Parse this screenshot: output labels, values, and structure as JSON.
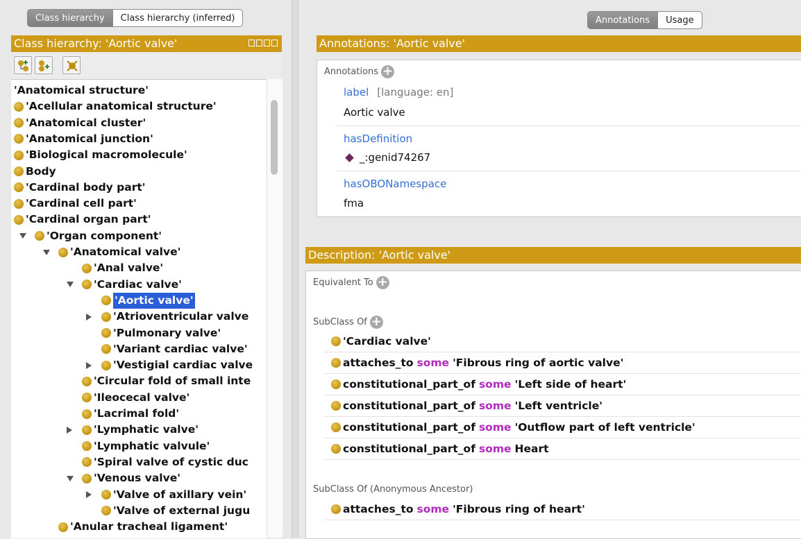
{
  "left_tabs": [
    "Class hierarchy",
    "Class hierarchy (inferred)"
  ],
  "class_hierarchy": {
    "title": "Class hierarchy: 'Aortic valve'",
    "tree": [
      {
        "label": "'Anatomical structure'",
        "level": 0,
        "toggle": "none",
        "bullet": false
      },
      {
        "label": "'Acellular anatomical structure'",
        "level": 0,
        "toggle": "none",
        "bullet": true
      },
      {
        "label": "'Anatomical cluster'",
        "level": 0,
        "toggle": "none",
        "bullet": true
      },
      {
        "label": "'Anatomical junction'",
        "level": 0,
        "toggle": "none",
        "bullet": true
      },
      {
        "label": "'Biological macromolecule'",
        "level": 0,
        "toggle": "none",
        "bullet": true
      },
      {
        "label": "Body",
        "level": 0,
        "toggle": "none",
        "bullet": true
      },
      {
        "label": "'Cardinal body part'",
        "level": 0,
        "toggle": "none",
        "bullet": true
      },
      {
        "label": "'Cardinal cell part'",
        "level": 0,
        "toggle": "none",
        "bullet": true
      },
      {
        "label": "'Cardinal organ part'",
        "level": 0,
        "toggle": "none",
        "bullet": true
      },
      {
        "label": "'Organ component'",
        "level": 1,
        "toggle": "open",
        "bullet": true
      },
      {
        "label": "'Anatomical valve'",
        "level": 2,
        "toggle": "open",
        "bullet": true
      },
      {
        "label": "'Anal valve'",
        "level": 3,
        "toggle": "none",
        "bullet": true
      },
      {
        "label": "'Cardiac valve'",
        "level": 3,
        "toggle": "open",
        "bullet": true
      },
      {
        "label": "'Aortic valve'",
        "level": 4,
        "toggle": "none",
        "bullet": true,
        "selected": true
      },
      {
        "label": "'Atrioventricular valve",
        "level": 4,
        "toggle": "closed",
        "bullet": true
      },
      {
        "label": "'Pulmonary valve'",
        "level": 4,
        "toggle": "none",
        "bullet": true
      },
      {
        "label": "'Variant cardiac valve'",
        "level": 4,
        "toggle": "none",
        "bullet": true
      },
      {
        "label": "'Vestigial cardiac valve",
        "level": 4,
        "toggle": "closed",
        "bullet": true
      },
      {
        "label": "'Circular fold of small inte",
        "level": 3,
        "toggle": "none",
        "bullet": true
      },
      {
        "label": "'Ileocecal valve'",
        "level": 3,
        "toggle": "none",
        "bullet": true
      },
      {
        "label": "'Lacrimal fold'",
        "level": 3,
        "toggle": "none",
        "bullet": true
      },
      {
        "label": "'Lymphatic valve'",
        "level": 3,
        "toggle": "closed",
        "bullet": true
      },
      {
        "label": "'Lymphatic valvule'",
        "level": 3,
        "toggle": "none",
        "bullet": true
      },
      {
        "label": "'Spiral valve of cystic duc",
        "level": 3,
        "toggle": "none",
        "bullet": true
      },
      {
        "label": "'Venous valve'",
        "level": 3,
        "toggle": "open",
        "bullet": true
      },
      {
        "label": "'Valve of axillary vein'",
        "level": 4,
        "toggle": "closed",
        "bullet": true
      },
      {
        "label": "'Valve of external jugu",
        "level": 4,
        "toggle": "none",
        "bullet": true
      },
      {
        "label": "'Anular tracheal ligament'",
        "level": 2,
        "toggle": "none",
        "bullet": true
      }
    ]
  },
  "right_tabs": [
    "Annotations",
    "Usage"
  ],
  "annotations": {
    "title": "Annotations: 'Aortic valve'",
    "header": "Annotations",
    "items": [
      {
        "property": "label",
        "lang": "[language: en]",
        "value": "Aortic valve"
      },
      {
        "property": "hasDefinition",
        "lang": "",
        "value": "_:genid74267"
      },
      {
        "property": "hasOBONamespace",
        "lang": "",
        "value": "fma"
      }
    ]
  },
  "description": {
    "title": "Description: 'Aortic valve'",
    "equivalent_to": "Equivalent To",
    "subclass_of": "SubClass Of",
    "subclass_items": [
      {
        "prop": "",
        "kw": "",
        "target": "'Cardiac valve'"
      },
      {
        "prop": "attaches_to",
        "kw": "some",
        "target": "'Fibrous ring of aortic valve'"
      },
      {
        "prop": "constitutional_part_of",
        "kw": "some",
        "target": "'Left side of heart'"
      },
      {
        "prop": "constitutional_part_of",
        "kw": "some",
        "target": "'Left ventricle'"
      },
      {
        "prop": "constitutional_part_of",
        "kw": "some",
        "target": "'Outflow part of left ventricle'"
      },
      {
        "prop": "constitutional_part_of",
        "kw": "some",
        "target": "Heart"
      }
    ],
    "anon_ancestor": "SubClass Of (Anonymous Ancestor)",
    "anon_items": [
      {
        "prop": "attaches_to",
        "kw": "some",
        "target": "'Fibrous ring of heart'"
      }
    ]
  },
  "icons": {
    "add": "plus-circle-icon",
    "class": "class-bullet-icon",
    "individual": "individual-diamond-icon"
  },
  "colors": {
    "section_bar": "#cf9b16",
    "selection": "#2b5fd9",
    "keyword": "#b12bbd",
    "annotation_property": "#3570d4"
  }
}
